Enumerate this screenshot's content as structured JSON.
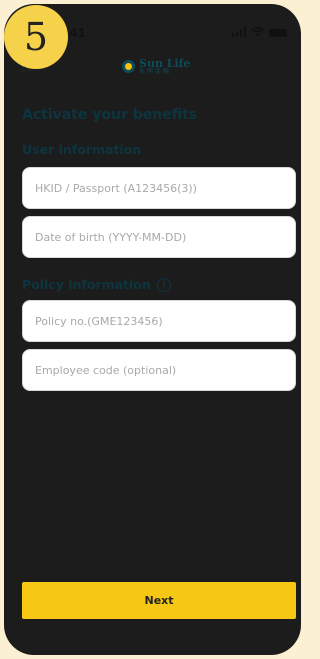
{
  "step_badge": "5",
  "status_bar": {
    "time": "9:41"
  },
  "header": {
    "back_icon": "arrow-left-icon",
    "logo_en": "Sun Life",
    "logo_zh": "永明金融"
  },
  "page_title": "Activate your benefits",
  "user_section": {
    "title": "User information",
    "fields": [
      {
        "placeholder": "HKID / Passport (A123456(3))",
        "value": ""
      },
      {
        "placeholder": "Date of birth (YYYY-MM-DD)",
        "value": ""
      }
    ]
  },
  "policy_section": {
    "title": "Policy information",
    "info_icon": "info-circle-icon",
    "fields": [
      {
        "placeholder": "Policy no.(GME123456)",
        "value": ""
      },
      {
        "placeholder": "Employee code (optional)",
        "value": ""
      }
    ]
  },
  "next_label": "Next",
  "colors": {
    "accent": "#F6C814",
    "heading": "#0d3540",
    "background": "#FBF1D2"
  }
}
